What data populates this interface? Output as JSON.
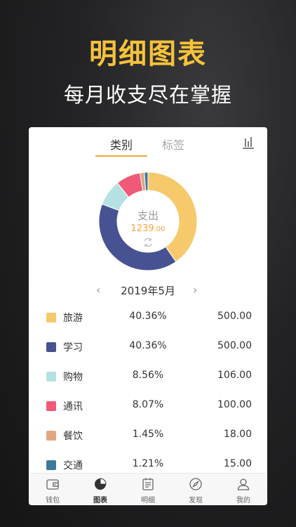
{
  "hero": {
    "title": "明细图表",
    "subtitle": "每月收支尽在掌握"
  },
  "tabs": [
    {
      "label": "类别",
      "active": true
    },
    {
      "label": "标签",
      "active": false
    }
  ],
  "donut": {
    "center_label": "支出",
    "amount_main": "1239",
    "amount_decimal": ".00"
  },
  "month": {
    "label": "2019年5月"
  },
  "categories": [
    {
      "name": "旅游",
      "percent": "40.36%",
      "amount": "500.00",
      "color": "#f6c96b"
    },
    {
      "name": "学习",
      "percent": "40.36%",
      "amount": "500.00",
      "color": "#465291"
    },
    {
      "name": "购物",
      "percent": "8.56%",
      "amount": "106.00",
      "color": "#b5e1e3"
    },
    {
      "name": "通讯",
      "percent": "8.07%",
      "amount": "100.00",
      "color": "#f05a78"
    },
    {
      "name": "餐饮",
      "percent": "1.45%",
      "amount": "18.00",
      "color": "#e2a680"
    },
    {
      "name": "交通",
      "percent": "1.21%",
      "amount": "15.00",
      "color": "#3f7a9e"
    }
  ],
  "tabbar": [
    {
      "label": "钱包",
      "icon": "wallet-icon",
      "active": false
    },
    {
      "label": "图表",
      "icon": "pie-chart-icon",
      "active": true
    },
    {
      "label": "明细",
      "icon": "calendar-icon",
      "active": false
    },
    {
      "label": "发现",
      "icon": "compass-icon",
      "active": false
    },
    {
      "label": "我的",
      "icon": "user-icon",
      "active": false
    }
  ],
  "chart_data": {
    "type": "pie",
    "categories": [
      "旅游",
      "学习",
      "购物",
      "通讯",
      "餐饮",
      "交通"
    ],
    "values": [
      500,
      500,
      106,
      100,
      18,
      15
    ],
    "percentages": [
      40.36,
      40.36,
      8.56,
      8.07,
      1.45,
      1.21
    ],
    "colors": [
      "#f6c96b",
      "#465291",
      "#b5e1e3",
      "#f05a78",
      "#e2a680",
      "#3f7a9e"
    ],
    "title": "",
    "donut": true
  }
}
